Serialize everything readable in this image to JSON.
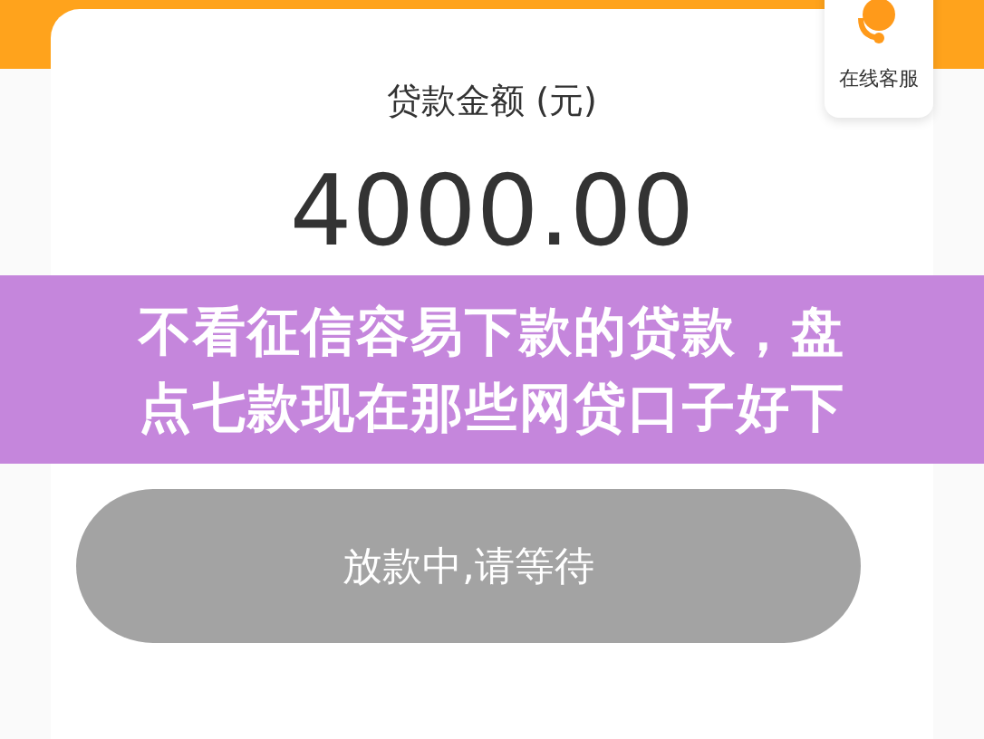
{
  "customer_service": {
    "label": "在线客服"
  },
  "loan": {
    "label": "贷款金额 (元)",
    "amount": "4000.00"
  },
  "status_button": {
    "label": "放款中,请等待"
  },
  "title_banner": {
    "lines": [
      "不看征信容易下款的贷款，盘",
      "点七款现在那些网贷口子好下"
    ]
  }
}
